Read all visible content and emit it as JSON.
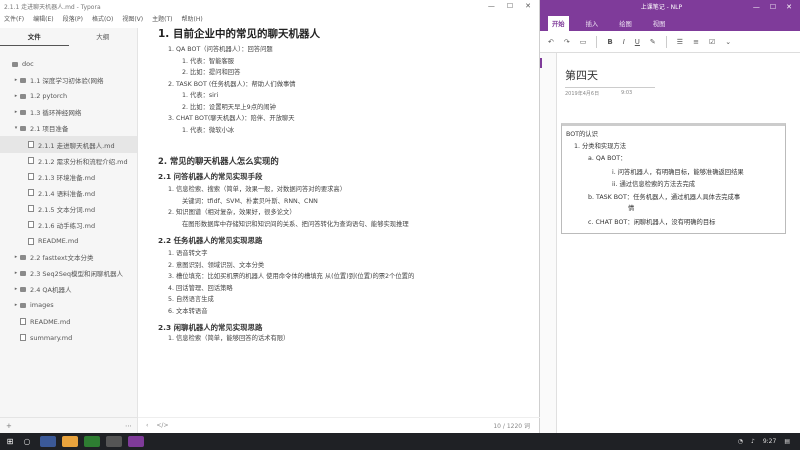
{
  "typora": {
    "title": "2.1.1 走进聊天机器人.md - Typora",
    "menu": [
      "文件(F)",
      "编辑(E)",
      "段落(P)",
      "格式(O)",
      "视图(V)",
      "主题(T)",
      "帮助(H)"
    ],
    "sidebar_tabs": [
      "文件",
      "大纲"
    ],
    "tree": [
      {
        "label": "doc",
        "type": "folder",
        "indent": 0,
        "toggle": ""
      },
      {
        "label": "1.1 深度学习初体验(网络",
        "type": "folder",
        "indent": 1,
        "toggle": "▸"
      },
      {
        "label": "1.2 pytorch",
        "type": "folder",
        "indent": 1,
        "toggle": "▸"
      },
      {
        "label": "1.3 循环神经网络",
        "type": "folder",
        "indent": 1,
        "toggle": "▸"
      },
      {
        "label": "2.1 项目准备",
        "type": "folder",
        "indent": 1,
        "toggle": "▾"
      },
      {
        "label": "2.1.1 走进聊天机器人.md",
        "type": "file",
        "indent": 2,
        "toggle": "",
        "selected": true
      },
      {
        "label": "2.1.2 需求分析和流程介绍.md",
        "type": "file",
        "indent": 2,
        "toggle": ""
      },
      {
        "label": "2.1.3 环境准备.md",
        "type": "file",
        "indent": 2,
        "toggle": ""
      },
      {
        "label": "2.1.4 语料准备.md",
        "type": "file",
        "indent": 2,
        "toggle": ""
      },
      {
        "label": "2.1.5 文本分词.md",
        "type": "file",
        "indent": 2,
        "toggle": ""
      },
      {
        "label": "2.1.6 动手练习.md",
        "type": "file",
        "indent": 2,
        "toggle": ""
      },
      {
        "label": "README.md",
        "type": "file",
        "indent": 2,
        "toggle": ""
      },
      {
        "label": "2.2 fasttext文本分类",
        "type": "folder",
        "indent": 1,
        "toggle": "▸"
      },
      {
        "label": "2.3 Seq2Seq模型和闲聊机器人",
        "type": "folder",
        "indent": 1,
        "toggle": "▸"
      },
      {
        "label": "2.4 QA机器人",
        "type": "folder",
        "indent": 1,
        "toggle": "▸"
      },
      {
        "label": "images",
        "type": "folder",
        "indent": 1,
        "toggle": "▸"
      },
      {
        "label": "README.md",
        "type": "file",
        "indent": 1,
        "toggle": ""
      },
      {
        "label": "summary.md",
        "type": "file",
        "indent": 1,
        "toggle": ""
      }
    ],
    "status_wordcount": "10 / 1220 词",
    "doc": {
      "h1": "1. 目前企业中的常见的聊天机器人",
      "list1": [
        {
          "level": 0,
          "text": "1. QA BOT（问答机器人）：回答问题"
        },
        {
          "level": 1,
          "text": "1. 代表：智能客服"
        },
        {
          "level": 1,
          "text": "2. 比如：提问和回答"
        },
        {
          "level": 0,
          "text": "2. TASK BOT (任务机器人)：帮助人们做事情"
        },
        {
          "level": 1,
          "text": "1. 代表：siri"
        },
        {
          "level": 1,
          "text": "2. 比如：设置明天早上9点的闹钟"
        },
        {
          "level": 0,
          "text": "3. CHAT BOT(聊天机器人)：陪伴、开放聊天"
        },
        {
          "level": 1,
          "text": "1. 代表：微软小冰"
        }
      ],
      "h2a": "2. 常见的聊天机器人怎么实现的",
      "h3a": "2.1 问答机器人的常见实现手段",
      "list2": [
        {
          "level": 0,
          "text": "1. 信息检索、搜索（简单，效果一般，对数据问答对的要求高）"
        },
        {
          "level": 1,
          "text": "关键词：tfidf、SVM、朴素贝叶斯、RNN、CNN"
        },
        {
          "level": 0,
          "text": "2. 知识图谱（相对复杂，效果好，很多论文）"
        },
        {
          "level": 1,
          "text": "在图形数据库中存储知识和知识间的关系、把问答转化为查询语句、能够实现推理"
        }
      ],
      "h3b": "2.2 任务机器人的常见实现思路",
      "list3": [
        "1. 语音转文字",
        "2. 意图识别、领域识别、文本分类",
        "3. 槽位填充：比如买机票的机器人 使用命令体的槽填充 从(位置)到(位置)的票2个位置的",
        "4. 回话管理、回话策略",
        "5. 自然语言生成",
        "6. 文本转语音"
      ],
      "h3c": "2.3 闲聊机器人的常见实现思路",
      "cut_line": "1. 信息检索（简单，能够回答的话术有限）"
    }
  },
  "onenote": {
    "title": "上课笔记 - NLP",
    "tabs": [
      "开始",
      "插入",
      "绘图",
      "视图"
    ],
    "page_title": "第四天",
    "date": "2019年4月6日",
    "time": "9:03",
    "note": {
      "heading": "BOT的认识",
      "l1": "1. 分类和实现方法",
      "a": "a. QA BOT：",
      "a_i": "i. 问答机器人，有明确目标，能够准确返回结果",
      "a_ii": "ii. 通过信息检索的方法去完成",
      "b": "b. TASK BOT：任务机器人，通过机器人具体去完成事",
      "b_cont": "情",
      "c": "c. CHAT BOT：闲聊机器人，没有明确的目标"
    }
  },
  "taskbar": {
    "time": "9:27"
  },
  "colors": {
    "onenote_purple": "#7f3b9a",
    "taskbar": "#1f2125"
  }
}
